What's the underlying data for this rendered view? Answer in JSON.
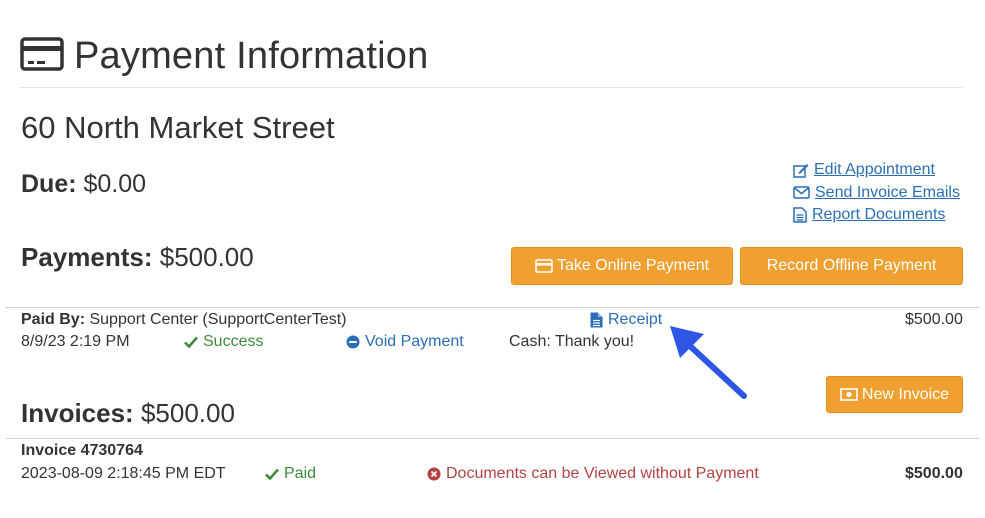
{
  "header": {
    "title": "Payment Information",
    "icon": "credit-card-icon"
  },
  "property": {
    "address": "60 North Market Street"
  },
  "due": {
    "label": "Due:",
    "amount": "$0.00"
  },
  "actions": {
    "edit_appointment": "Edit Appointment",
    "send_invoice_emails": "Send Invoice Emails",
    "report_documents": "Report Documents"
  },
  "payments": {
    "label": "Payments:",
    "amount": "$500.00",
    "take_online_payment": "Take Online Payment",
    "record_offline_payment": "Record Offline Payment",
    "items": [
      {
        "paid_by_label": "Paid By:",
        "paid_by": "Support Center (SupportCenterTest)",
        "receipt": "Receipt",
        "amount": "$500.00",
        "datetime": "8/9/23 2:19 PM",
        "status": "Success",
        "void": "Void Payment",
        "note": "Cash: Thank you!"
      }
    ]
  },
  "invoices": {
    "label": "Invoices:",
    "amount": "$500.00",
    "new_invoice": "New Invoice",
    "items": [
      {
        "title": "Invoice 4730764",
        "datetime": "2023-08-09 2:18:45 PM EDT",
        "status": "Paid",
        "documents_note": "Documents can be Viewed without Payment",
        "amount": "$500.00"
      }
    ]
  },
  "colors": {
    "accent_orange": "#f0a030",
    "link_blue": "#2a6fb5",
    "success_green": "#3c8a3c",
    "error_red": "#b34242",
    "annotation_arrow": "#2f55e6"
  }
}
